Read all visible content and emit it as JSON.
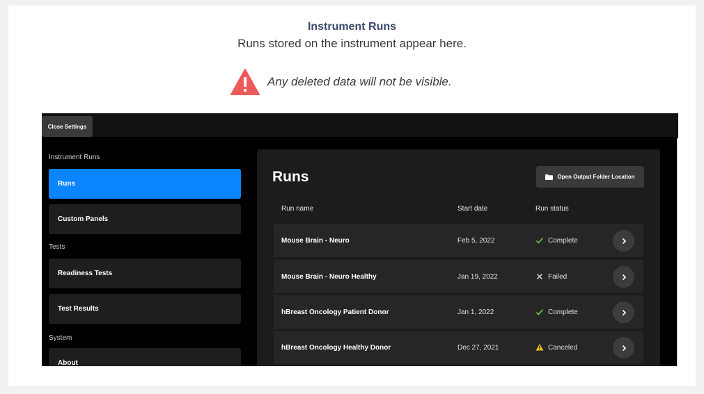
{
  "header": {
    "title": "Instrument Runs",
    "subtitle": "Runs stored on the instrument appear here.",
    "warning": "Any deleted data will not be visible."
  },
  "topbar": {
    "close_label": "Close Settings"
  },
  "sidebar": {
    "sections": [
      {
        "label": "Instrument Runs",
        "items": [
          {
            "label": "Runs",
            "active": true
          },
          {
            "label": "Custom Panels"
          }
        ]
      },
      {
        "label": "Tests",
        "items": [
          {
            "label": "Readiness Tests"
          },
          {
            "label": "Test Results"
          }
        ]
      },
      {
        "label": "System",
        "items": [
          {
            "label": "About"
          }
        ]
      }
    ]
  },
  "main": {
    "title": "Runs",
    "open_folder_label": "Open Output Folder Location",
    "columns": {
      "name": "Run name",
      "date": "Start date",
      "status": "Run status"
    },
    "rows": [
      {
        "name": "Mouse Brain - Neuro",
        "date": "Feb 5, 2022",
        "status": "Complete",
        "status_icon": "check-icon"
      },
      {
        "name": "Mouse Brain - Neuro Healthy",
        "date": "Jan 19, 2022",
        "status": "Failed",
        "status_icon": "x-icon"
      },
      {
        "name": "hBreast Oncology Patient Donor",
        "date": "Jan 1, 2022",
        "status": "Complete",
        "status_icon": "check-icon"
      },
      {
        "name": "hBreast Oncology Healthy Donor",
        "date": "Dec 27, 2021",
        "status": "Canceled",
        "status_icon": "warning-icon"
      }
    ]
  },
  "colors": {
    "accent": "#0a84ff",
    "warning_red": "#ee5a5a",
    "complete_green": "#6ccf45",
    "canceled_yellow": "#f5c518"
  }
}
